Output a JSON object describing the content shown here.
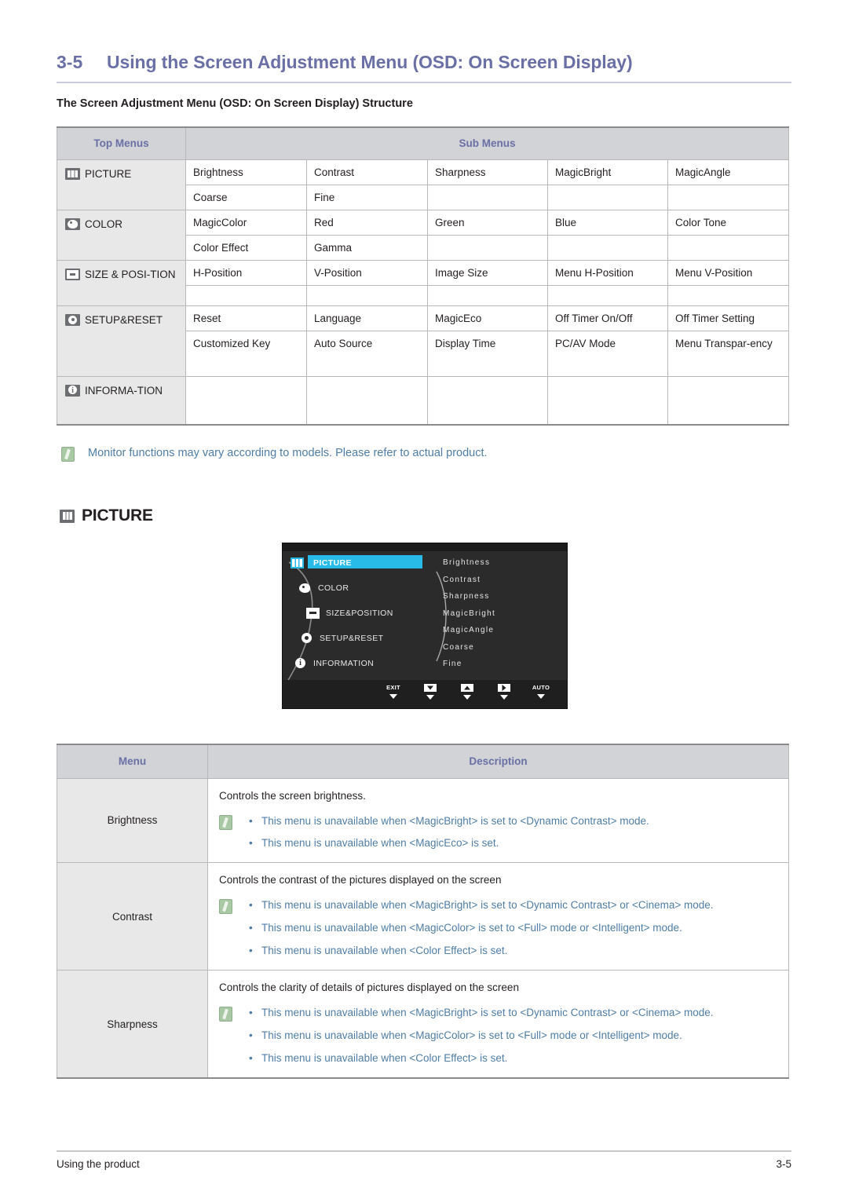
{
  "header": {
    "section_number": "3-5",
    "section_title": "Using the Screen Adjustment Menu (OSD: On Screen Display)",
    "structure_title": "The Screen Adjustment Menu (OSD: On Screen Display) Structure",
    "accent_color": "#6a6fa6"
  },
  "structure_table": {
    "col_headers": [
      "Top Menus",
      "Sub Menus"
    ],
    "groups": [
      {
        "icon": "picture-icon",
        "label": "PICTURE",
        "rows": [
          [
            "Brightness",
            "Contrast",
            "Sharpness",
            "MagicBright",
            "MagicAngle"
          ],
          [
            "Coarse",
            "Fine",
            "",
            "",
            ""
          ]
        ]
      },
      {
        "icon": "color-palette-icon",
        "label": "COLOR",
        "rows": [
          [
            "MagicColor",
            "Red",
            "Green",
            "Blue",
            "Color Tone"
          ],
          [
            "Color Effect",
            "Gamma",
            "",
            "",
            ""
          ]
        ]
      },
      {
        "icon": "size-position-icon",
        "label": "SIZE & POSI-TION",
        "rows": [
          [
            "H-Position",
            "V-Position",
            "Image Size",
            "Menu H-Position",
            "Menu V-Position"
          ],
          [
            "",
            "",
            "",
            "",
            ""
          ]
        ]
      },
      {
        "icon": "setup-reset-icon",
        "label": "SETUP&RESET",
        "rows": [
          [
            "Reset",
            "Language",
            "MagicEco",
            "Off Timer On/Off",
            "Off Timer Setting"
          ],
          [
            "Customized Key",
            "Auto Source",
            "Display Time",
            "PC/AV Mode",
            "Menu Transpar-ency"
          ]
        ]
      },
      {
        "icon": "information-icon",
        "label": "INFORMA-TION",
        "rows": [
          [
            "",
            "",
            "",
            "",
            ""
          ]
        ]
      }
    ]
  },
  "note": {
    "icon": "note-pencil-icon",
    "text": "Monitor functions may vary according to models. Please refer to actual product.",
    "color": "#4f7da5"
  },
  "picture_section": {
    "icon": "picture-icon",
    "title": "PICTURE"
  },
  "osd": {
    "highlight_color": "#29bbe8",
    "background_color": "#2b2b2b",
    "menu_items": [
      {
        "icon": "picture-icon",
        "label": "PICTURE",
        "active": true
      },
      {
        "icon": "color-palette-icon",
        "label": "COLOR",
        "active": false
      },
      {
        "icon": "size-position-icon",
        "label": "SIZE&POSITION",
        "active": false
      },
      {
        "icon": "setup-reset-icon",
        "label": "SETUP&RESET",
        "active": false
      },
      {
        "icon": "information-icon",
        "label": "INFORMATION",
        "active": false
      }
    ],
    "sub_items": [
      "Brightness",
      "Contrast",
      "Sharpness",
      "MagicBright",
      "MagicAngle",
      "Coarse",
      "Fine"
    ],
    "buttons": [
      {
        "name": "exit-button",
        "label": "EXIT",
        "glyph": "text"
      },
      {
        "name": "down-button",
        "label": "",
        "glyph": "down"
      },
      {
        "name": "up-button",
        "label": "",
        "glyph": "up"
      },
      {
        "name": "enter-button",
        "label": "",
        "glyph": "right"
      },
      {
        "name": "auto-button",
        "label": "AUTO",
        "glyph": "text"
      },
      {
        "name": "power-button",
        "label": "",
        "glyph": "power"
      }
    ]
  },
  "description_table": {
    "col_headers": [
      "Menu",
      "Description"
    ],
    "rows": [
      {
        "menu": "Brightness",
        "lead": "Controls the screen brightness.",
        "bullets": [
          "This menu is unavailable when <MagicBright> is set to <Dynamic Contrast> mode.",
          "This menu is unavailable when <MagicEco> is set."
        ]
      },
      {
        "menu": "Contrast",
        "lead": "Controls the contrast of the pictures displayed on the screen",
        "bullets": [
          "This menu is unavailable when <MagicBright> is set to <Dynamic Contrast> or <Cinema> mode.",
          "This menu is unavailable when <MagicColor> is set to <Full> mode or <Intelligent> mode.",
          "This menu is unavailable when <Color Effect> is set."
        ]
      },
      {
        "menu": "Sharpness",
        "lead": "Controls the clarity of details of pictures displayed on the screen",
        "bullets": [
          "This menu is unavailable when <MagicBright> is set to <Dynamic Contrast> or <Cinema> mode.",
          "This menu is unavailable when <MagicColor> is set to <Full> mode or <Intelligent> mode.",
          "This menu is unavailable when <Color Effect> is set."
        ]
      }
    ]
  },
  "footer": {
    "left": "Using the product",
    "right": "3-5"
  }
}
